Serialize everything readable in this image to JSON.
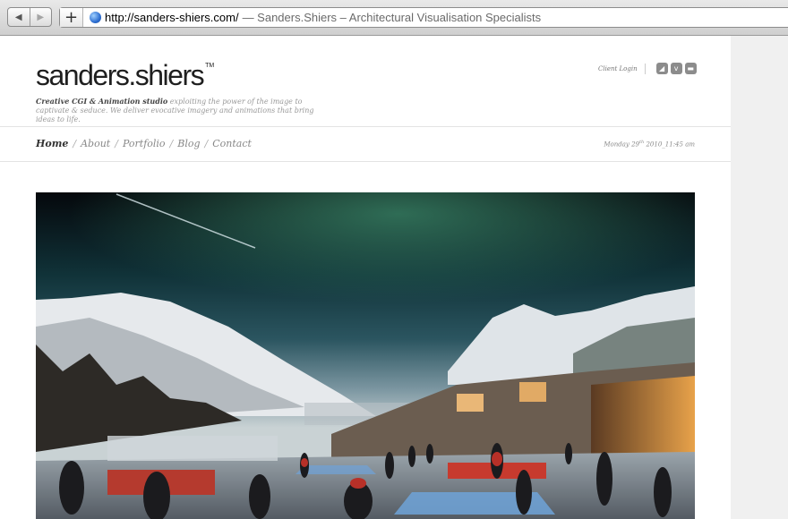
{
  "browser": {
    "url": "http://sanders-shiers.com/",
    "title": "— Sanders.Shiers – Architectural Visualisation Specialists"
  },
  "site": {
    "logo": "sanders.shiers",
    "trademark": "TM",
    "tagline_bold": "Creative CGI & Animation studio",
    "tagline_rest": " exploiting the power of the image to captivate & seduce. We deliver evocative imagery and animations that bring ideas to life.",
    "client_login": "Client Login",
    "social": [
      {
        "icon": "delicious-icon",
        "glyph": "◢"
      },
      {
        "icon": "vimeo-icon",
        "glyph": "v"
      },
      {
        "icon": "chat-icon",
        "glyph": "▬"
      }
    ]
  },
  "nav": {
    "items": [
      "Home",
      "About",
      "Portfolio",
      "Blog",
      "Contact"
    ],
    "active": "Home"
  },
  "date": {
    "day": "Monday 29",
    "suffix": "th",
    "rest": " 2010_11:45 am"
  },
  "hero": {
    "description_icon": "winter-plaza-rendering"
  }
}
